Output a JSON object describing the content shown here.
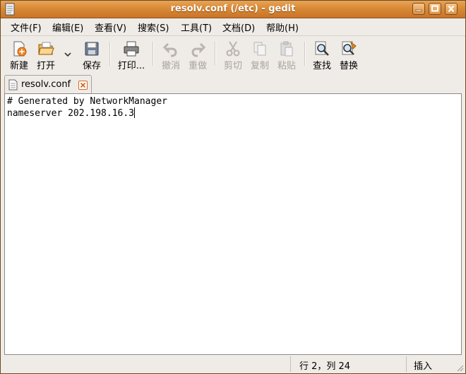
{
  "window": {
    "title": "resolv.conf (/etc) - gedit"
  },
  "menu": [
    {
      "label": "文件(F)"
    },
    {
      "label": "编辑(E)"
    },
    {
      "label": "查看(V)"
    },
    {
      "label": "搜索(S)"
    },
    {
      "label": "工具(T)"
    },
    {
      "label": "文档(D)"
    },
    {
      "label": "帮助(H)"
    }
  ],
  "toolbar": {
    "new": "新建",
    "open": "打开",
    "save": "保存",
    "print": "打印...",
    "undo": "撤消",
    "redo": "重做",
    "cut": "剪切",
    "copy": "复制",
    "paste": "粘贴",
    "find": "查找",
    "replace": "替换"
  },
  "tabs": [
    {
      "label": "resolv.conf"
    }
  ],
  "editor": {
    "lines": [
      "# Generated by NetworkManager",
      "nameserver 202.198.16.3"
    ]
  },
  "status": {
    "position": "行 2，列 24",
    "mode": "插入"
  },
  "colors": {
    "titlebar": "#d98a35",
    "window_bg": "#efebe7",
    "tab_close": "#d76a20"
  }
}
